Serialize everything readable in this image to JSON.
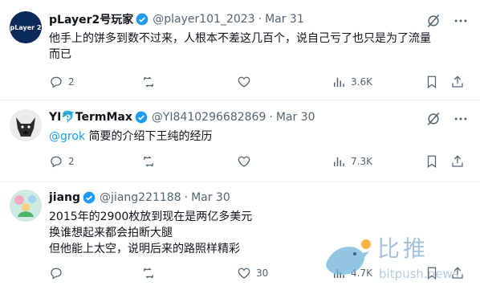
{
  "tweets": [
    {
      "name": "pLayer2号玩家",
      "handle": "@player101_2023",
      "time": "Mar 31",
      "text_lines": [
        "他手上的饼多到数不过来，人根本不差这几百个，说自己亏了也只是为了流量",
        "而已"
      ],
      "replies": "2",
      "retweets": "",
      "likes": "",
      "views": "3.6K",
      "avatar_text": "pLayer 2",
      "avatar_bg": "#0c2a5a"
    },
    {
      "name": "YI🐬TermMax",
      "handle": "@YI8410296682869",
      "time": "Mar 30",
      "mention": "@grok",
      "text": " 简要的介绍下王纯的经历",
      "replies": "2",
      "retweets": "",
      "likes": "",
      "views": "7.3K"
    },
    {
      "name": "jiang",
      "handle": "@jiang221188",
      "time": "Mar 30",
      "text_lines": [
        "2015年的2900枚放到现在是两亿多美元",
        "换谁想起来都会拍断大腿",
        "但他能上太空，说明后来的路照样精彩"
      ],
      "replies": "",
      "retweets": "",
      "likes": "30",
      "views": "4.7K"
    }
  ],
  "watermark": {
    "brand": "比推",
    "url": "bitpush.news"
  },
  "colors": {
    "accent": "#1d9bf0",
    "muted": "#536471",
    "verified": "#1d9bf0"
  }
}
